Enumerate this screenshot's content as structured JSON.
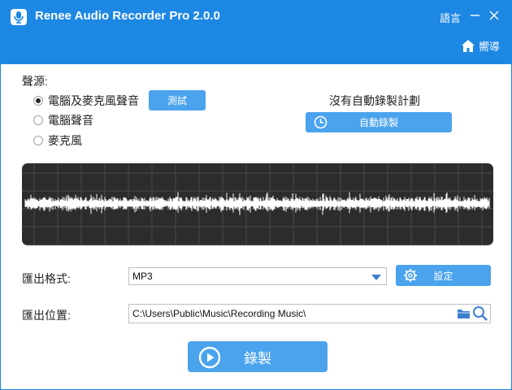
{
  "window": {
    "title": "Renee Audio Recorder Pro 2.0.0",
    "language_label": "語言",
    "home_label": "嚮導",
    "accent_color": "#1d87e4",
    "button_color": "#4aa3ec"
  },
  "source": {
    "label": "聲源:",
    "options": [
      {
        "label": "電腦及麥克風聲音",
        "selected": true
      },
      {
        "label": "電腦聲音",
        "selected": false
      },
      {
        "label": "麥克風",
        "selected": false
      }
    ],
    "test_button": "測試"
  },
  "schedule": {
    "status": "沒有自動錄製計劃",
    "auto_button": "自動錄製"
  },
  "output": {
    "format_label": "匯出格式:",
    "format_value": "MP3",
    "settings_button": "設定",
    "location_label": "匯出位置:",
    "location_value": "C:\\Users\\Public\\Music\\Recording Music\\"
  },
  "record_button": "錄製"
}
